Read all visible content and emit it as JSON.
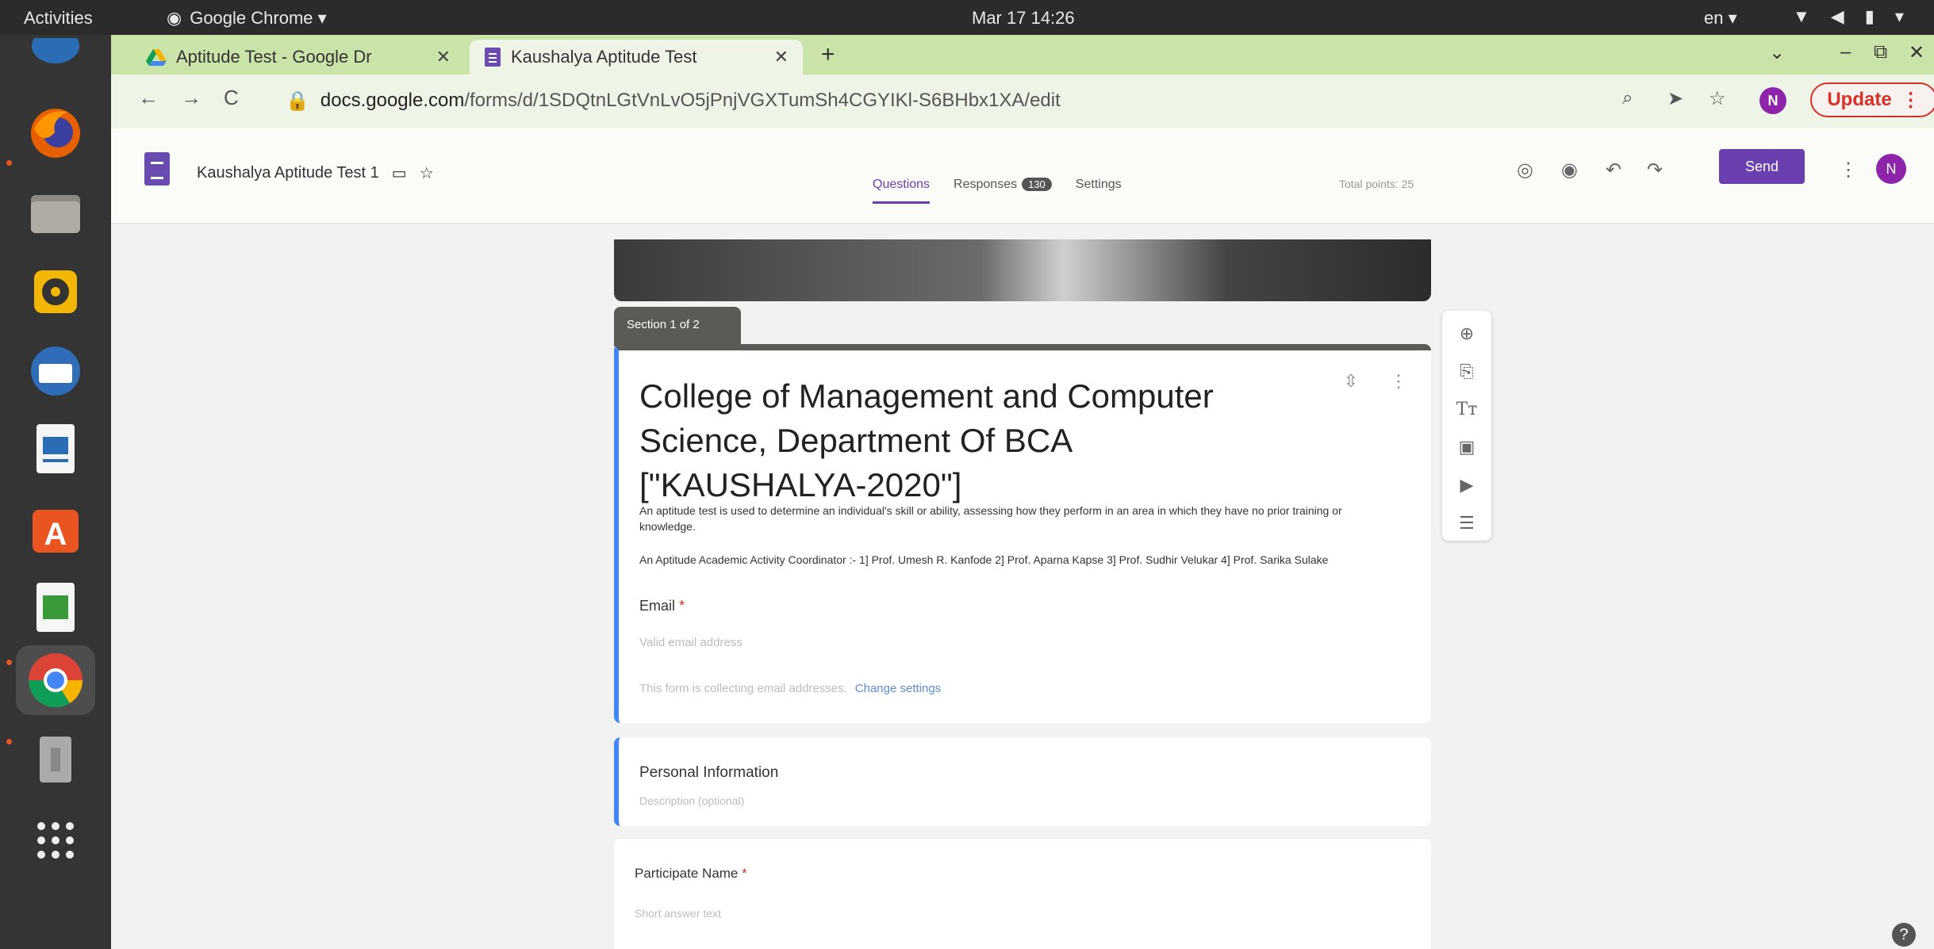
{
  "topbar": {
    "activities": "Activities",
    "app_name": "Google Chrome ▾",
    "clock": "Mar 17  14:26",
    "lang": "en ▾"
  },
  "browser": {
    "tabs": [
      {
        "label": "Aptitude Test - Google Dr",
        "icon": "drive-icon"
      },
      {
        "label": "Kaushalya Aptitude Test",
        "icon": "forms-icon"
      }
    ],
    "url_host": "docs.google.com",
    "url_path": "/forms/d/1SDQtnLGtVnLvO5jPnjVGXTumSh4CGYIKl-S6BHbx1XA/edit",
    "profile_initial": "N",
    "update_label": "Update"
  },
  "forms": {
    "doc_title": "Kaushalya Aptitude Test 1",
    "send_label": "Send",
    "user_initial": "N",
    "tabs": {
      "questions": "Questions",
      "responses": "Responses",
      "responses_count": "130",
      "settings": "Settings"
    },
    "total_points": "Total points: 25",
    "section_label": "Section 1 of 2",
    "form_title": "College of Management and Computer Science, Department Of BCA [\"KAUSHALYA-2020\"]",
    "description_1": "An aptitude test is used to determine an individual's skill or ability, assessing how they perform in an area in which they have no prior training or knowledge.",
    "description_2": "An Aptitude Academic Activity Coordinator :- 1] Prof. Umesh R. Kanfode 2] Prof. Aparna Kapse 3] Prof. Sudhir Velukar 4] Prof. Sarika Sulake",
    "email_label": "Email",
    "email_placeholder": "Valid email address",
    "collect_text": "This form is collecting email addresses.",
    "change_settings": "Change settings",
    "section2_title": "Personal Information",
    "section2_desc": "Description (optional)",
    "q1_title": "Participate Name",
    "q1_placeholder": "Short answer text"
  },
  "colors": {
    "accent": "#6a3fb0",
    "chrome_tabstrip": "#c9e3a9",
    "ubuntu_topbar": "#2b2b2b",
    "dock": "#343434",
    "active_question": "#4285f4"
  }
}
